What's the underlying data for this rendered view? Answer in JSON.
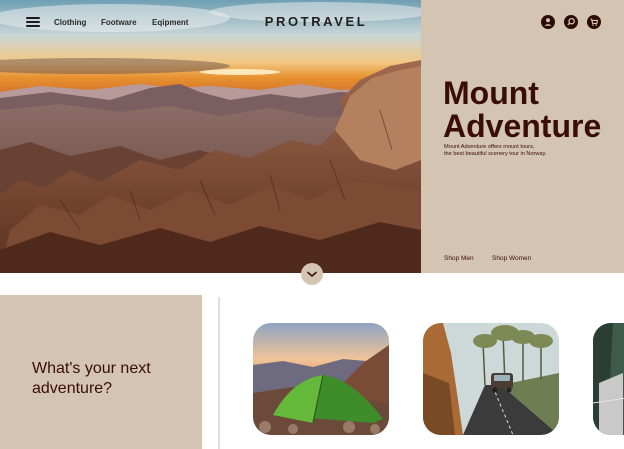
{
  "header": {
    "nav_links": [
      "Clothing",
      "Footware",
      "Eqipment"
    ],
    "brand": "PROTRAVEL",
    "icons": [
      "user-icon",
      "search-icon",
      "cart-icon"
    ]
  },
  "hero": {
    "title_line1": "Mount",
    "title_line2": "Adventure",
    "tagline_line1": "Mount Adventure offers mount tours,",
    "tagline_line2": "the best beautiful scenery tour in Norway.",
    "shop_links": [
      "Shop Men",
      "Shop Women"
    ],
    "scroll_icon": "chevron-down-icon"
  },
  "promo": {
    "line1": "What's your next",
    "line2": "adventure?"
  },
  "cards": [
    {
      "name": "tent-on-rocks"
    },
    {
      "name": "car-on-road"
    },
    {
      "name": "forest-partial"
    }
  ],
  "colors": {
    "panel": "#d4c4b2",
    "accent": "#3a0d05",
    "text_dark": "#1f1f1f"
  }
}
